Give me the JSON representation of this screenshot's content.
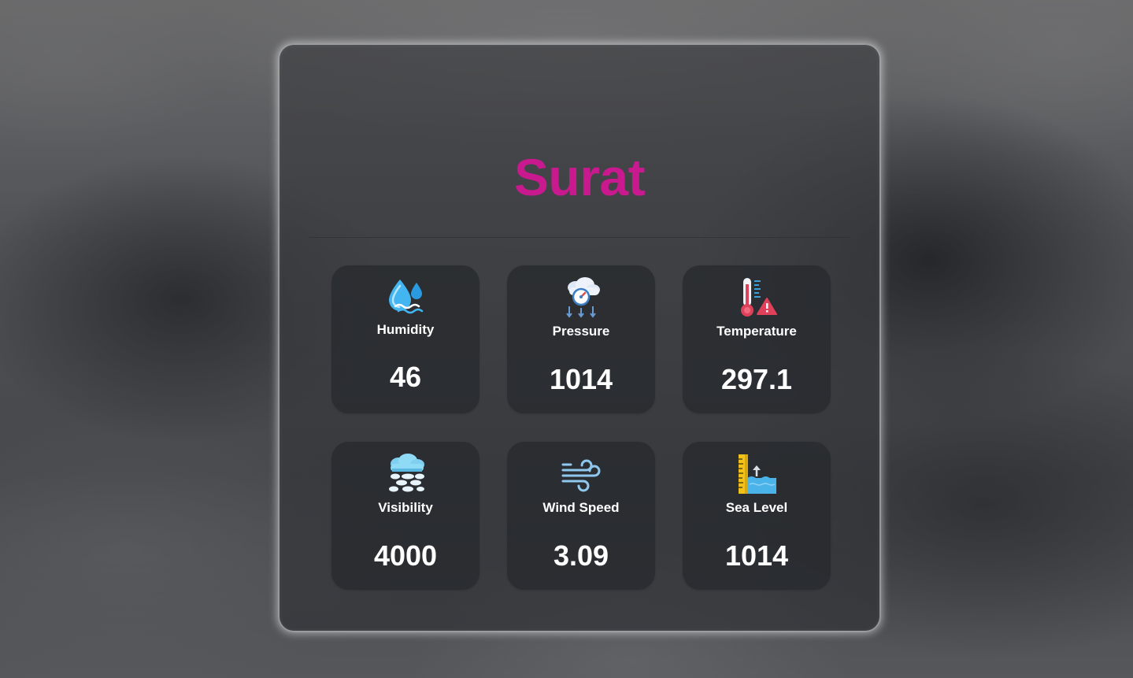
{
  "city": {
    "name": "Surat",
    "color": "#c8198f"
  },
  "metrics": [
    {
      "label": "Humidity",
      "value": "46",
      "icon": "humidity-icon"
    },
    {
      "label": "Pressure",
      "value": "1014",
      "icon": "pressure-icon"
    },
    {
      "label": "Temperature",
      "value": "297.1",
      "icon": "temperature-icon"
    },
    {
      "label": "Visibility",
      "value": "4000",
      "icon": "visibility-icon"
    },
    {
      "label": "Wind Speed",
      "value": "3.09",
      "icon": "wind-speed-icon"
    },
    {
      "label": "Sea Level",
      "value": "1014",
      "icon": "sea-level-icon"
    }
  ]
}
